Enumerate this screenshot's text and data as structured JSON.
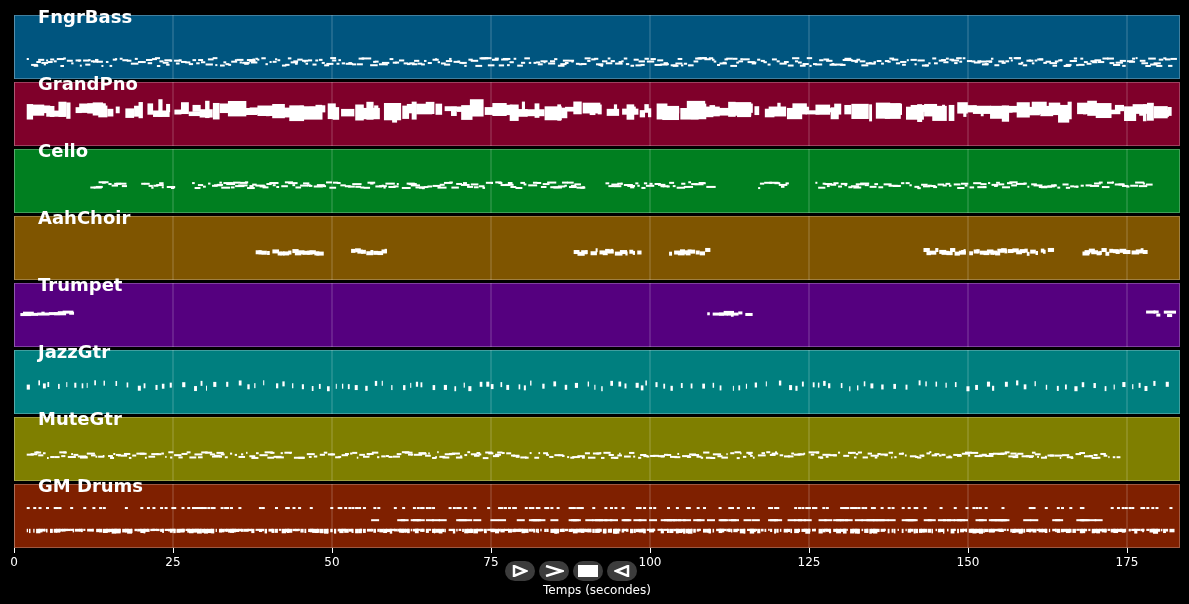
{
  "tracks": [
    {
      "name": "FngrBass",
      "color": "#00557f"
    },
    {
      "name": "GrandPno",
      "color": "#7f002a"
    },
    {
      "name": "Cello",
      "color": "#007f20"
    },
    {
      "name": "AahChoir",
      "color": "#7f5500"
    },
    {
      "name": "Trumpet",
      "color": "#55007f"
    },
    {
      "name": "JazzGtr",
      "color": "#007f7f"
    },
    {
      "name": "MuteGtr",
      "color": "#7f7f00"
    },
    {
      "name": "GM Drums",
      "color": "#7f2000"
    }
  ],
  "axis": {
    "ticks": [
      "0",
      "25",
      "50",
      "75",
      "100",
      "125",
      "150",
      "175"
    ],
    "label": "Temps (secondes)"
  },
  "controls": [
    {
      "kind": "play"
    },
    {
      "kind": "forward"
    },
    {
      "kind": "stop"
    },
    {
      "kind": "back"
    }
  ]
}
